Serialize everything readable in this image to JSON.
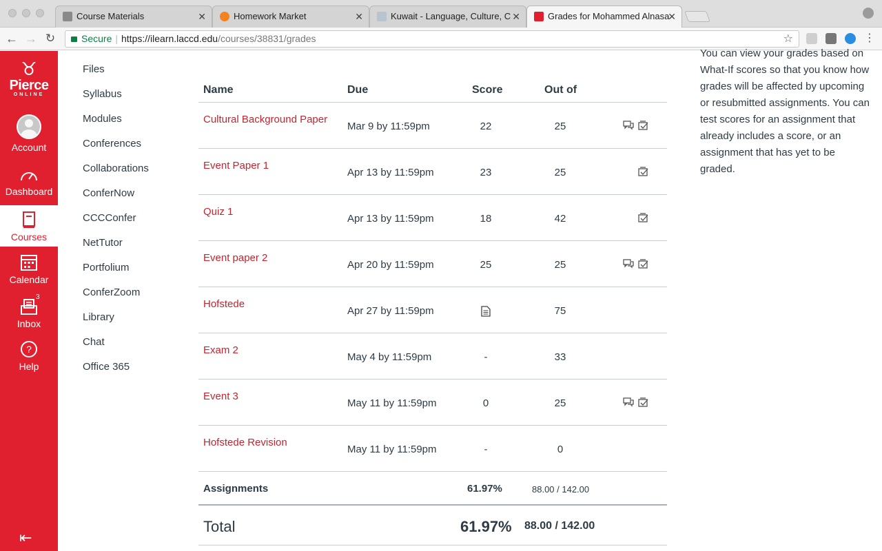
{
  "browser": {
    "tabs": [
      {
        "title": "Course Materials",
        "active": false
      },
      {
        "title": "Homework Market",
        "active": false
      },
      {
        "title": "Kuwait - Language, Culture, C",
        "active": false
      },
      {
        "title": "Grades for Mohammed Alnasa",
        "active": true
      }
    ],
    "address": {
      "secure_label": "Secure",
      "host": "https://ilearn.laccd.edu",
      "path": "/courses/38831/grades"
    }
  },
  "global_nav": {
    "logo": {
      "main": "Pierce",
      "sub": "ONLINE"
    },
    "items": [
      {
        "label": "Account",
        "icon": "avatar-icon"
      },
      {
        "label": "Dashboard",
        "icon": "dashboard-icon"
      },
      {
        "label": "Courses",
        "icon": "courses-icon",
        "active": true
      },
      {
        "label": "Calendar",
        "icon": "calendar-icon"
      },
      {
        "label": "Inbox",
        "icon": "inbox-icon",
        "badge": "3"
      },
      {
        "label": "Help",
        "icon": "help-icon"
      }
    ],
    "accent": "#e0202f"
  },
  "course_nav": [
    "Files",
    "Syllabus",
    "Modules",
    "Conferences",
    "Collaborations",
    "ConferNow",
    "CCCConfer",
    "NetTutor",
    "Portfolium",
    "ConferZoom",
    "Library",
    "Chat",
    "Office 365"
  ],
  "grades": {
    "headers": {
      "name": "Name",
      "due": "Due",
      "score": "Score",
      "out_of": "Out of"
    },
    "rows": [
      {
        "name": "Cultural Background Paper",
        "due": "Mar 9 by 11:59pm",
        "score": "22",
        "out_of": "25",
        "comment": true,
        "rubric": true
      },
      {
        "name": "Event Paper 1",
        "due": "Apr 13 by 11:59pm",
        "score": "23",
        "out_of": "25",
        "comment": false,
        "rubric": true
      },
      {
        "name": "Quiz 1",
        "due": "Apr 13 by 11:59pm",
        "score": "18",
        "out_of": "42",
        "comment": false,
        "rubric": true
      },
      {
        "name": "Event paper 2",
        "due": "Apr 20 by 11:59pm",
        "score": "25",
        "out_of": "25",
        "comment": true,
        "rubric": true
      },
      {
        "name": "Hofstede",
        "due": "Apr 27 by 11:59pm",
        "score": "",
        "score_icon": "submitted-document-icon",
        "out_of": "75",
        "comment": false,
        "rubric": false
      },
      {
        "name": "Exam 2",
        "due": "May 4 by 11:59pm",
        "score": "-",
        "out_of": "33",
        "comment": false,
        "rubric": false
      },
      {
        "name": "Event 3",
        "due": "May 11 by 11:59pm",
        "score": "0",
        "out_of": "25",
        "comment": true,
        "rubric": true
      },
      {
        "name": "Hofstede Revision",
        "due": "May 11 by 11:59pm",
        "score": "-",
        "out_of": "0",
        "comment": false,
        "rubric": false
      }
    ],
    "assignments_summary": {
      "label": "Assignments",
      "percent": "61.97%",
      "fraction": "88.00 / 142.00"
    },
    "total": {
      "label": "Total",
      "percent": "61.97%",
      "fraction": "88.00 / 142.00"
    }
  },
  "sidebar_info": {
    "text": "You can view your grades based on What-If scores so that you know how grades will be affected by upcoming or resubmitted assignments. You can test scores for an assignment that already includes a score, or an assignment that has yet to be graded."
  }
}
